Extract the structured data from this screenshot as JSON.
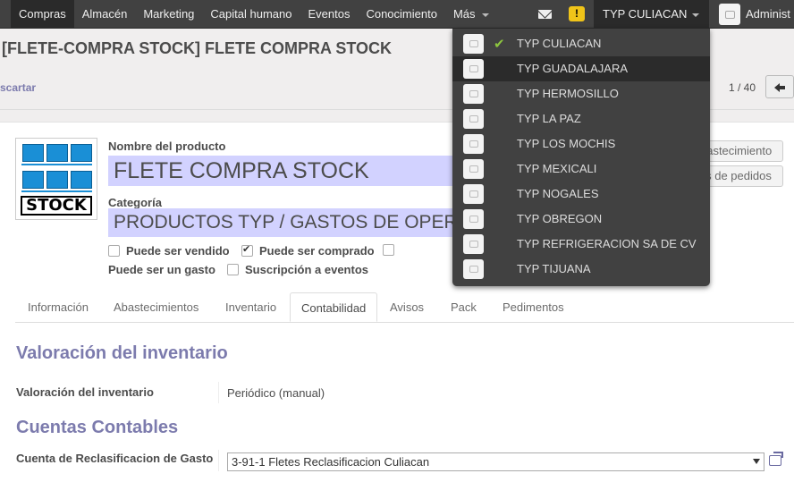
{
  "top_menu": {
    "items": [
      "Compras",
      "Almacén",
      "Marketing",
      "Capital humano",
      "Eventos",
      "Conocimiento",
      "Más"
    ],
    "company": "TYP CULIACAN",
    "user": "Administ",
    "warning": "!"
  },
  "header": {
    "title": "[FLETE-COMPRA STOCK] FLETE COMPRA STOCK",
    "discard": "scartar",
    "pager": "1 / 40"
  },
  "product": {
    "image_text": "STOCK",
    "name_label": "Nombre del producto",
    "name": "FLETE COMPRA STOCK",
    "category_label": "Categoría",
    "category": "PRODUCTOS TYP / GASTOS DE OPERACIÓN",
    "checks": {
      "sold_label": "Puede ser vendido",
      "sold": false,
      "purchased_label": "Puede ser comprado",
      "purchased": true,
      "expense_label": "Puede ser un gasto",
      "event_label": "Suscripción a eventos",
      "event": false
    }
  },
  "buttons": {
    "procurement": "Pedir abastecimiento",
    "order_points": "Puntos de pedidos"
  },
  "tabs": [
    "Información",
    "Abastecimientos",
    "Inventario",
    "Contabilidad",
    "Avisos",
    "Pack",
    "Pedimentos"
  ],
  "active_tab": "Contabilidad",
  "accounting": {
    "valuation_title": "Valoración del inventario",
    "valuation_label": "Valoración del inventario",
    "valuation_value": "Periódico (manual)",
    "accounts_title": "Cuentas Contables",
    "reclass_label": "Cuenta de Reclasificacion de Gasto",
    "reclass_value": "3-91-1 Fletes Reclasificacion Culiacan"
  },
  "company_dropdown": {
    "items": [
      "TYP CULIACAN",
      "TYP GUADALAJARA",
      "TYP HERMOSILLO",
      "TYP LA PAZ",
      "TYP LOS MOCHIS",
      "TYP MEXICALI",
      "TYP NOGALES",
      "TYP OBREGON",
      "TYP REFRIGERACION SA DE CV",
      "TYP TIJUANA"
    ],
    "selected": "TYP CULIACAN",
    "hovered": "TYP GUADALAJARA"
  },
  "colors": {
    "topbar": "#414141",
    "accent": "#7c7bad",
    "input_highlight": "#d2d2ff",
    "check_green": "#8dc63f"
  }
}
